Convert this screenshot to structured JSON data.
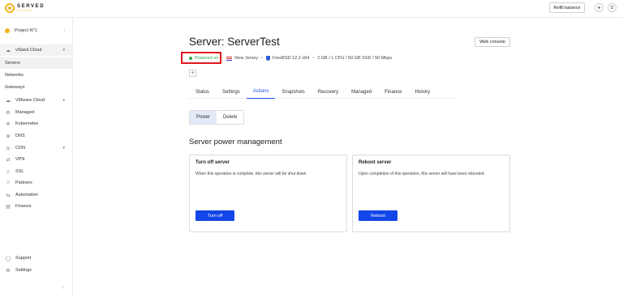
{
  "brand": {
    "name": "SERVED",
    "tagline": "CLOUD",
    "color": "#f3b51d"
  },
  "header": {
    "refill_label": "Refill balance",
    "plus_symbol": "+",
    "avatar_letter": "D"
  },
  "sidebar": {
    "project": "Project N°1",
    "vstack": "vStack Cloud",
    "vstack_items": [
      "Servers",
      "Networks",
      "Gateways"
    ],
    "items": [
      "VMware Cloud",
      "Managed",
      "Kubernetes",
      "DNS",
      "CDN",
      "VPN",
      "SSL",
      "Partners",
      "Automation",
      "Finance"
    ],
    "footer": [
      "Support",
      "Settings"
    ],
    "icons": [
      "cloud-icon",
      "managed-icon",
      "kubernetes-icon",
      "dns-icon",
      "cdn-icon",
      "vpn-icon",
      "ssl-icon",
      "partners-icon",
      "automation-icon",
      "finance-icon"
    ]
  },
  "page": {
    "title": "Server: ServerTest",
    "web_console": "Web console",
    "status": "Powered on",
    "location": "New Jersey",
    "os": "FreeBSD 12.2 x64",
    "specs": "2 GB / 1 CPU / 50 GB SSD / 50 Mbps",
    "tag_add": "+",
    "status_color": "#2ca84c"
  },
  "tabs": [
    "Status",
    "Settings",
    "Actions",
    "Snapshots",
    "Recovery",
    "Managed",
    "Finance",
    "History"
  ],
  "active_tab": "Actions",
  "segments": {
    "power": "Power",
    "delete": "Delete"
  },
  "section_title": "Server power management",
  "cards": {
    "off": {
      "title": "Turn off server",
      "desc": "When this operation is complete, this server will be shut down",
      "button": "Turn off"
    },
    "reboot": {
      "title": "Reboot server",
      "desc": "Upon completion of this operation, this server will have been rebooted.",
      "button": "Reboot"
    }
  },
  "accent_color": "#1e50e6"
}
